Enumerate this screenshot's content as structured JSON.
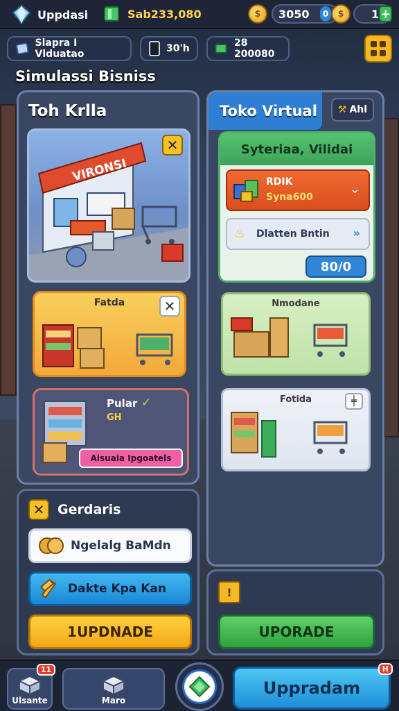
{
  "topbar": {
    "title": "Uppdasi",
    "gems": "Sab233,080",
    "coins": "3050",
    "coins_icon_text": "0",
    "premium": "1"
  },
  "subbar": {
    "chip1": "Slapra I Vlduatao",
    "chip2": "30'h",
    "chip3": "28 200080"
  },
  "section_title": "Simulassi Bisniss",
  "left_panel": {
    "title": "Toh Krlla",
    "hero_sign": "VIRONSI",
    "orange_card_label": "Fatda",
    "purple_card_title": "Pular",
    "purple_card_sub": "GH",
    "purple_card_button": "Alsuaia Ipgoatels"
  },
  "bottom_left": {
    "title": "Gerdaris",
    "btn_white": "Ngelalg BaMdn",
    "btn_blue": "Dakte Kpa Kan",
    "btn_yellow": "1UPDNADE"
  },
  "right_panel": {
    "tab_label": "Toko Virtual",
    "tab_icon_text": "Ahl",
    "green_header": "Syteriaa, Vilidai",
    "row_orange_title": "RDIK",
    "row_orange_sub": "Syna600",
    "row_light": "Dlatten Bntin",
    "count": "80/0",
    "card_green_label": "Nmodane",
    "card_white_label": "Fotida"
  },
  "bottom_right": {
    "btn_green": "UPORADE"
  },
  "bottomnav": {
    "item1": "Ulsante",
    "item1_badge": "11",
    "item2": "Maro",
    "upgrade": "Uppradam",
    "upgrade_badge": "H"
  },
  "colors": {
    "accent_blue": "#2e7fd4",
    "accent_yellow": "#f3b824",
    "accent_green": "#3ea25a",
    "panel": "#3a4763"
  }
}
